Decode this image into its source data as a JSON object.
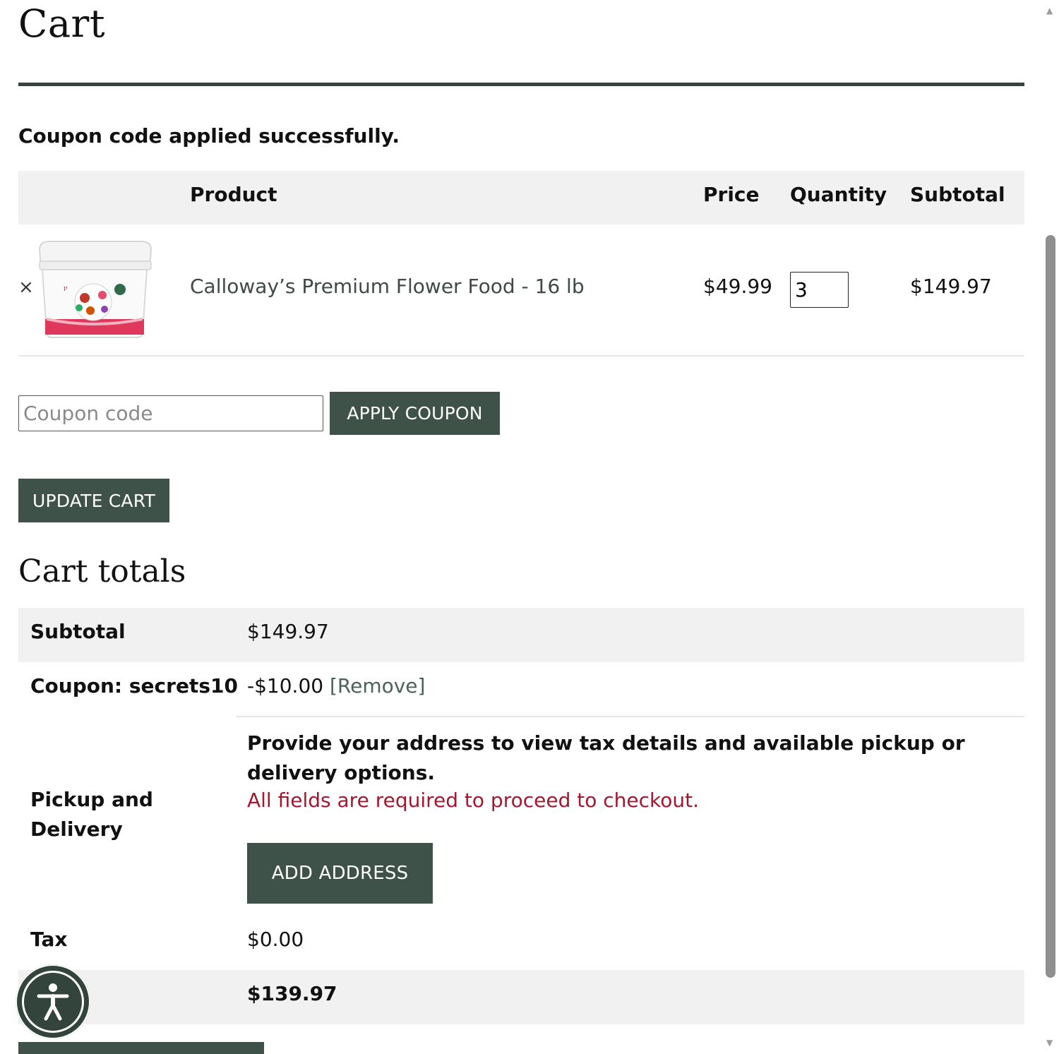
{
  "page": {
    "title": "Cart"
  },
  "notice": "Coupon code applied successfully.",
  "cart_table": {
    "headers": {
      "product": "Product",
      "price": "Price",
      "quantity": "Quantity",
      "subtotal": "Subtotal"
    },
    "items": [
      {
        "remove_glyph": "×",
        "name": "Calloway’s Premium Flower Food - 16 lb",
        "price": "$49.99",
        "quantity": "3",
        "subtotal": "$149.97",
        "image_icon": "product-bucket-image"
      }
    ]
  },
  "coupon": {
    "placeholder": "Coupon code",
    "value": "",
    "apply_label": "APPLY COUPON"
  },
  "update_label": "UPDATE CART",
  "totals": {
    "title": "Cart totals",
    "subtotal_label": "Subtotal",
    "subtotal_value": "$149.97",
    "coupon_label": "Coupon: secrets10",
    "coupon_value": "-$10.00",
    "coupon_remove": "[Remove]",
    "shipping_label": "Pickup and Delivery",
    "shipping_message": "Provide your address to view tax details and available pickup or delivery options.",
    "shipping_error": "All fields are required to proceed to checkout.",
    "add_address_label": "ADD ADDRESS",
    "tax_label": "Tax",
    "tax_value": "$0.00",
    "total_value": "$139.97"
  },
  "accessibility_icon": "accessibility-person-icon",
  "colors": {
    "primary": "#3f524a",
    "rule": "#33443d",
    "error": "#a2182e",
    "band": "#f1f1f1"
  }
}
